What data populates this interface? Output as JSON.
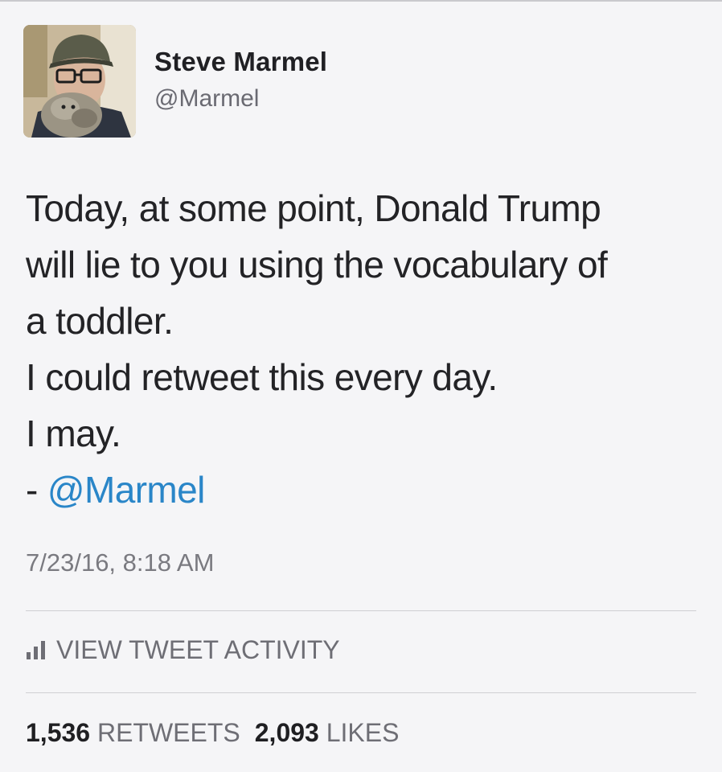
{
  "author": {
    "display_name": "Steve Marmel",
    "handle": "@Marmel"
  },
  "tweet": {
    "lines": [
      "Today, at some point, Donald Trump",
      "will lie to you using the vocabulary of",
      "a toddler.",
      "I could retweet this every day.",
      "I may."
    ],
    "signature_prefix": "- ",
    "signature_mention": "@Marmel",
    "timestamp": "7/23/16, 8:18 AM"
  },
  "activity": {
    "icon": "bar-chart-icon",
    "label": "VIEW TWEET ACTIVITY"
  },
  "stats": {
    "retweets_count": "1,536",
    "retweets_label": "RETWEETS",
    "likes_count": "2,093",
    "likes_label": "LIKES"
  },
  "colors": {
    "background": "#f5f5f7",
    "text": "#232326",
    "secondary_text": "#6e6e75",
    "link": "#2a86c8",
    "divider": "#cfcfd3"
  }
}
